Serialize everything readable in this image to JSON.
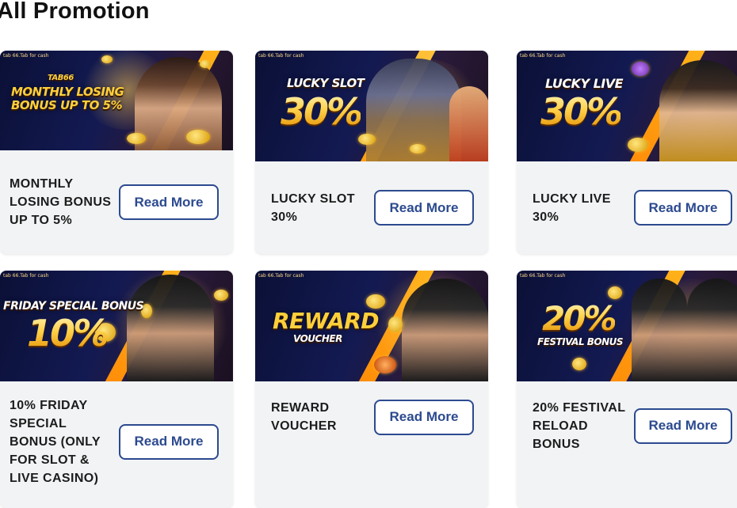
{
  "page": {
    "title": "All Promotion"
  },
  "read_more_label": "Read More",
  "banner_tag": "tab 66.Tab for cash",
  "cards": [
    {
      "title": "MONTHLY LOSING BONUS UP TO 5%",
      "banner_brand": "TAB66",
      "banner_headline": "MONTHLY LOSING\nBONUS UP TO 5%",
      "banner_percent": ""
    },
    {
      "title": "LUCKY SLOT 30%",
      "banner_headline": "LUCKY SLOT",
      "banner_percent": "30%"
    },
    {
      "title": "LUCKY LIVE 30%",
      "banner_headline": "LUCKY LIVE",
      "banner_percent": "30%"
    },
    {
      "title": "10% FRIDAY SPECIAL BONUS (ONLY FOR SLOT & LIVE CASINO)",
      "banner_headline": "FRIDAY SPECIAL BONUS",
      "banner_percent": "10%"
    },
    {
      "title": "REWARD VOUCHER",
      "banner_headline": "REWARD",
      "banner_sub": "VOUCHER",
      "banner_percent": ""
    },
    {
      "title": "20% FESTIVAL RELOAD BONUS",
      "banner_headline": "FESTIVAL BONUS",
      "banner_percent": "20%"
    }
  ],
  "colors": {
    "accent": "#2c4a8f",
    "card_bg": "#f1f3f5",
    "banner_gold": "#ffd24a"
  }
}
